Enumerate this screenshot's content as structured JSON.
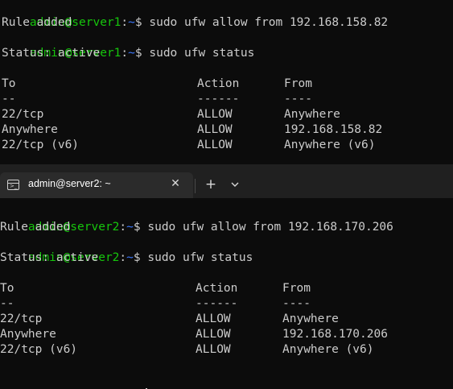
{
  "pane1": {
    "prompt_user": "admin@server1",
    "prompt_colon": ":",
    "prompt_path": "~",
    "prompt_dollar": "$",
    "cmd1": " sudo ufw allow from 192.168.158.82",
    "out1": "Rule added",
    "cmd2": " sudo ufw status",
    "status": "Status: active",
    "headers": [
      "To",
      "Action",
      "From"
    ],
    "separators": [
      "--",
      "------",
      "----"
    ],
    "rows": [
      [
        "22/tcp",
        "ALLOW",
        "Anywhere"
      ],
      [
        "Anywhere",
        "ALLOW",
        "192.168.158.82"
      ],
      [
        "22/tcp (v6)",
        "ALLOW",
        "Anywhere (v6)"
      ]
    ]
  },
  "tabbar": {
    "tab_title": "admin@server2: ~",
    "close_glyph": "✕",
    "new_tab_glyph": "+",
    "icons": [
      "terminal-icon",
      "close-icon",
      "plus-icon",
      "chevron-down-icon"
    ]
  },
  "pane2": {
    "prompt_user": "admin@server2",
    "prompt_colon": ":",
    "prompt_path": "~",
    "prompt_dollar": "$",
    "cmd1": " sudo ufw allow from 192.168.170.206",
    "out1": "Rule added",
    "cmd2": " sudo ufw status",
    "status": "Status: active",
    "headers": [
      "To",
      "Action",
      "From"
    ],
    "separators": [
      "--",
      "------",
      "----"
    ],
    "rows": [
      [
        "22/tcp",
        "ALLOW",
        "Anywhere"
      ],
      [
        "Anywhere",
        "ALLOW",
        "192.168.170.206"
      ],
      [
        "22/tcp (v6)",
        "ALLOW",
        "Anywhere (v6)"
      ]
    ]
  },
  "colors": {
    "background": "#0c0c0c",
    "prompt_user": "#16c60c",
    "prompt_path": "#3b78ff",
    "text": "#cccccc",
    "tab_active": "#2b2b2b",
    "tabstrip": "#202020"
  }
}
